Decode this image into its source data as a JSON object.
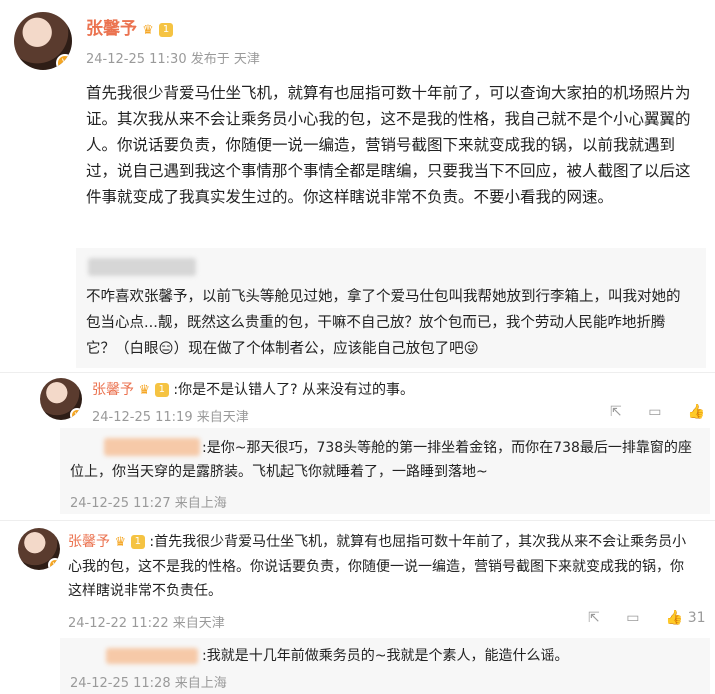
{
  "post": {
    "author": "张馨予",
    "level_badge": "1",
    "meta": "24-12-25 11:30 发布于 天津",
    "text": "首先我很少背爱马仕坐飞机，就算有也屈指可数十年前了，可以查询大家拍的机场照片为证。其次我从来不会让乘务员小心我的包，这不是我的性格，我自己就不是个小心翼翼的人。你说话要负责，你随便一说一编造，营销号截图下来就变成我的锅，以前我就遇到过，说自己遇到我这个事情那个事情全都是瞎编，只要我当下不回应，被人截图了以后这件事就变成了我真实发生过的。你这样瞎说非常不负责。不要小看我的网速。"
  },
  "quoted": {
    "text": "不咋喜欢张馨予，以前飞头等舱见过她，拿了个爱马仕包叫我帮她放到行李箱上，叫我对她的包当心点...靓，既然这么贵重的包，干嘛不自己放？放个包而已，我个劳动人民能咋地折腾它？（白眼😑）现在做了个体制者公，应该能自己放包了吧😜"
  },
  "comments": [
    {
      "author": "张馨予",
      "level_badge": "1",
      "text": ":你是不是认错人了? 从来没有过的事。",
      "meta": "24-12-25 11:19 来自天津",
      "reply": {
        "text": ":是你~那天很巧，738头等舱的第一排坐着金铭，而你在738最后一排靠窗的座位上，你当天穿的是露脐装。飞机起飞你就睡着了，一路睡到落地~",
        "meta": "24-12-25 11:27 来自上海"
      }
    },
    {
      "author": "张馨予",
      "level_badge": "1",
      "text": ":首先我很少背爱马仕坐飞机，就算有也屈指可数十年前了，其次我从来不会让乘务员小心我的包，这不是我的性格。你说话要负责，你随便一说一编造，营销号截图下来就变成我的锅，你这样瞎说非常不负责任。",
      "meta": "24-12-22 11:22 来自天津",
      "like_count": "31",
      "reply": {
        "text": ":我就是十几年前做乘务员的~我就是个素人，能造什么谣。",
        "meta": "24-12-25 11:28 来自上海"
      }
    }
  ]
}
